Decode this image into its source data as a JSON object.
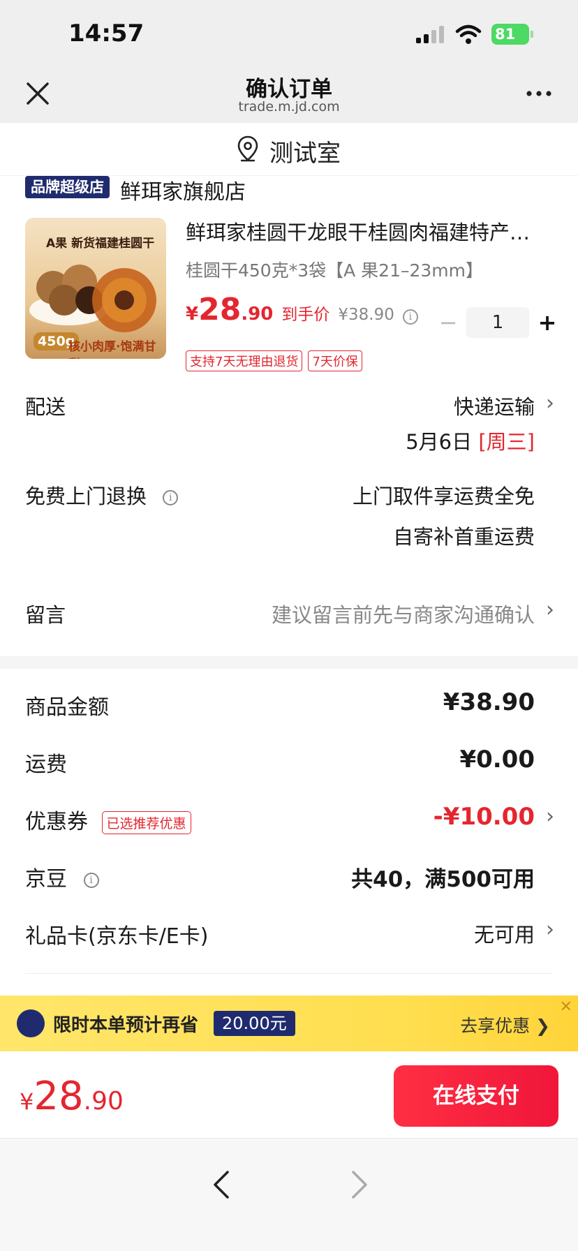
{
  "status_bar": {
    "time": "14:57",
    "battery": "81"
  },
  "nav": {
    "title": "确认订单",
    "subtitle": "trade.m.jd.com"
  },
  "address": {
    "text": "测试室"
  },
  "store": {
    "badge": "品牌超级店",
    "name": "鲜珥家旗舰店"
  },
  "product": {
    "title": "鲜珥家桂圆干龙眼干桂圆肉福建特产…",
    "spec": "桂圆干450克*3袋【A 果21–23mm】",
    "currency": "¥",
    "price_int": "28",
    "price_dec": ".90",
    "price_label": "到手价",
    "orig_price": "¥38.90",
    "quantity": "1",
    "tags": [
      "支持7天无理由退货",
      "7天价保"
    ],
    "image_texts": {
      "headline": "A果 新货福建桂圆干",
      "weight": "450g",
      "slogan": "核小肉厚·饱满甘甜"
    }
  },
  "delivery": {
    "label": "配送",
    "method": "快递运输",
    "date": "5月6日",
    "weekday": "[周三]"
  },
  "returns": {
    "label": "免费上门退换",
    "line1": "上门取件享运费全免",
    "line2": "自寄补首重运费"
  },
  "message": {
    "label": "留言",
    "placeholder": "建议留言前先与商家沟通确认"
  },
  "summary": {
    "goods_label": "商品金额",
    "goods_value": "¥38.90",
    "shipping_label": "运费",
    "shipping_value": "¥0.00",
    "coupon_label": "优惠券",
    "coupon_tag": "已选推荐优惠",
    "coupon_value": "-¥10.00",
    "jingdou_label": "京豆",
    "jingdou_value": "共40，满500可用",
    "giftcard_label": "礼品卡(京东卡/E卡)",
    "giftcard_value": "无可用"
  },
  "promo": {
    "text": "限时本单预计再省",
    "amount": "20.00元",
    "cta": "去享优惠 ❯",
    "close": "✕"
  },
  "bottom": {
    "currency": "¥",
    "total_int": "28",
    "total_dec": ".90",
    "pay_label": "在线支付"
  },
  "colors": {
    "accent_red": "#e4262f",
    "brand_navy": "#1f2b6e",
    "promo_yellow": "#ffe066"
  }
}
